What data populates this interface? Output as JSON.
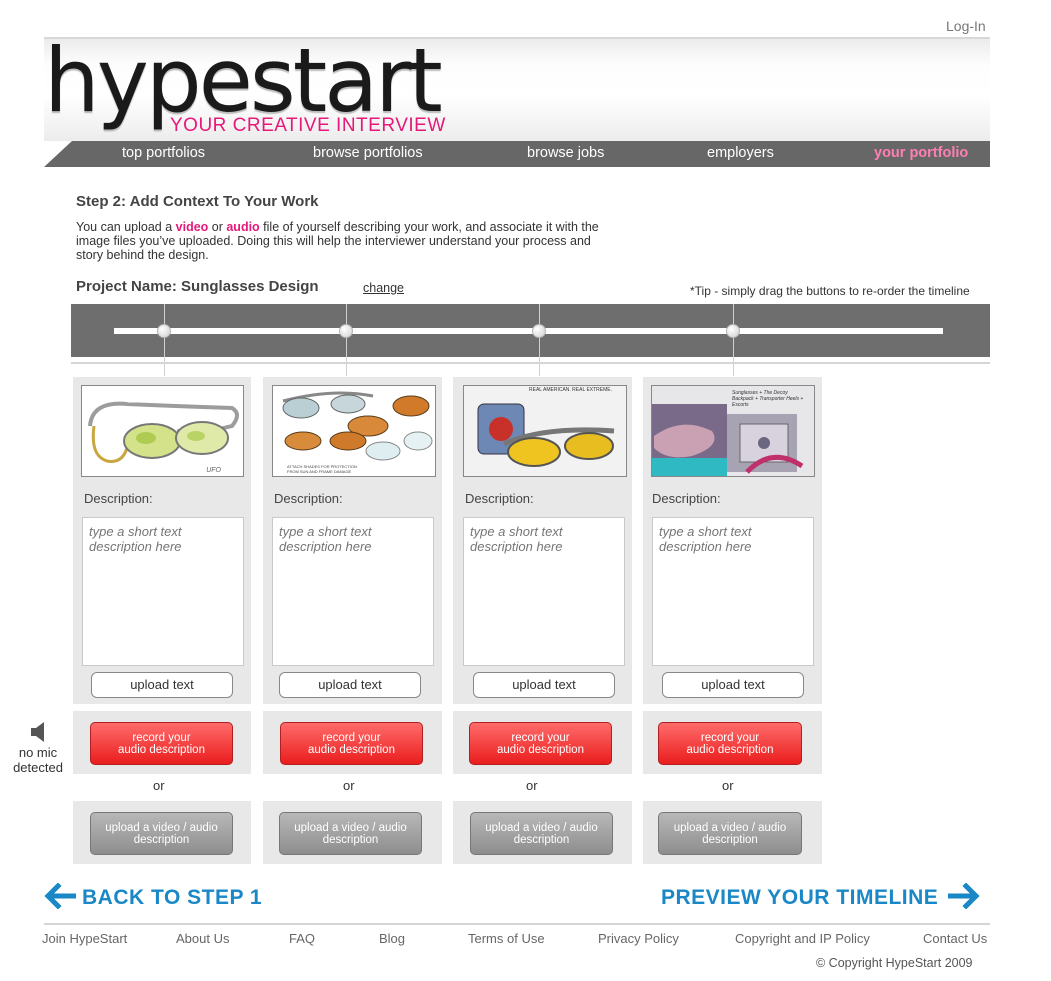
{
  "header": {
    "login_label": "Log-In",
    "logo_text": "hypestart",
    "tagline": "YOUR CREATIVE INTERVIEW"
  },
  "nav": {
    "items": [
      {
        "label": "top portfolios",
        "active": false
      },
      {
        "label": "browse portfolios",
        "active": false
      },
      {
        "label": "browse jobs",
        "active": false
      },
      {
        "label": "employers",
        "active": false
      },
      {
        "label": "your portfolio",
        "active": true
      }
    ]
  },
  "step": {
    "title": "Step 2: Add Context To Your Work",
    "intro_part1": "You can upload a ",
    "intro_video": "video",
    "intro_or": " or ",
    "intro_audio": "audio",
    "intro_part2": " file of yourself describing your work, and associate it with the image files you’ve uploaded. Doing this will help the interviewer understand your process and story behind the design."
  },
  "project": {
    "label": "Project Name: Sunglasses Design",
    "change_label": "change",
    "tip": "*Tip - simply drag the buttons to re-order the timeline"
  },
  "cards": [
    {
      "description_label": "Description:",
      "placeholder": "type a short text description here",
      "upload_text_label": "upload text",
      "record_label_1": "record your",
      "record_label_2": "audio description",
      "or_label": "or",
      "video_label_1": "upload a video / audio",
      "video_label_2": "description",
      "thumb_caption": "UFO"
    },
    {
      "description_label": "Description:",
      "placeholder": "type a short text description here",
      "upload_text_label": "upload text",
      "record_label_1": "record your",
      "record_label_2": "audio description",
      "or_label": "or",
      "video_label_1": "upload a video / audio",
      "video_label_2": "description",
      "thumb_caption": "ATTACH SHADES FOR PROTECTION FROM SUN AND FRAME DAMAGE"
    },
    {
      "description_label": "Description:",
      "placeholder": "type a short text description here",
      "upload_text_label": "upload text",
      "record_label_1": "record your",
      "record_label_2": "audio description",
      "or_label": "or",
      "video_label_1": "upload a video / audio",
      "video_label_2": "description",
      "thumb_caption": "REAL AMERICAN. REAL EXTREME."
    },
    {
      "description_label": "Description:",
      "placeholder": "type a short text description here",
      "upload_text_label": "upload text",
      "record_label_1": "record your",
      "record_label_2": "audio description",
      "or_label": "or",
      "video_label_1": "upload a video / audio",
      "video_label_2": "description",
      "thumb_caption": "Sunglasses + The Decoy Backpack + Transporter Heels + Escorts"
    }
  ],
  "mic": {
    "status_line1": "no mic",
    "status_line2": "detected",
    "icon": "speaker-icon"
  },
  "bottom_nav": {
    "back_label": "BACK TO STEP 1",
    "preview_label": "PREVIEW YOUR TIMELINE"
  },
  "footer": {
    "links": [
      "Join HypeStart",
      "About Us",
      "FAQ",
      "Blog",
      "Terms of Use",
      "Privacy Policy",
      "Copyright and IP Policy",
      "Contact Us"
    ],
    "copyright": "©  Copyright HypeStart 2009"
  },
  "colors": {
    "accent_pink": "#e5197a",
    "link_blue": "#1a87c6",
    "nav_gray": "#676767",
    "record_red": "#ea1d1d"
  }
}
